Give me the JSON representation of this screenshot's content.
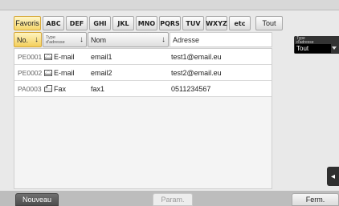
{
  "tabs": [
    {
      "label": "Favoris",
      "active": true
    },
    {
      "label": "ABC"
    },
    {
      "label": "DEF"
    },
    {
      "label": "GHI"
    },
    {
      "label": "JKL"
    },
    {
      "label": "MNO"
    },
    {
      "label": "PQRS"
    },
    {
      "label": "TUV"
    },
    {
      "label": "WXYZ"
    },
    {
      "label": "etc"
    },
    {
      "label": "Tout"
    }
  ],
  "columns": {
    "no": "No.",
    "type_line1": "Type",
    "type_line2": "d'adresse",
    "name": "Nom",
    "address": "Adresse"
  },
  "rows": [
    {
      "id": "PE0001",
      "type": "E-mail",
      "icon": "email-icon",
      "name": "email1",
      "address": "test1@email.eu"
    },
    {
      "id": "PE0002",
      "type": "E-mail",
      "icon": "email-icon",
      "name": "email2",
      "address": "test2@email.eu"
    },
    {
      "id": "PA0003",
      "type": "Fax",
      "icon": "fax-icon",
      "name": "fax1",
      "address": "0511234567"
    }
  ],
  "filter": {
    "label_line1": "Type",
    "label_line2": "d'adresse",
    "value": "Tout"
  },
  "footer": {
    "new_label": "Nouveau",
    "param_label": "Param.",
    "close_label": "Ferm."
  },
  "colors": {
    "active_tab": "#f5d66a",
    "background": "#e9e9e9",
    "footer_bar": "#bdbdbd"
  }
}
